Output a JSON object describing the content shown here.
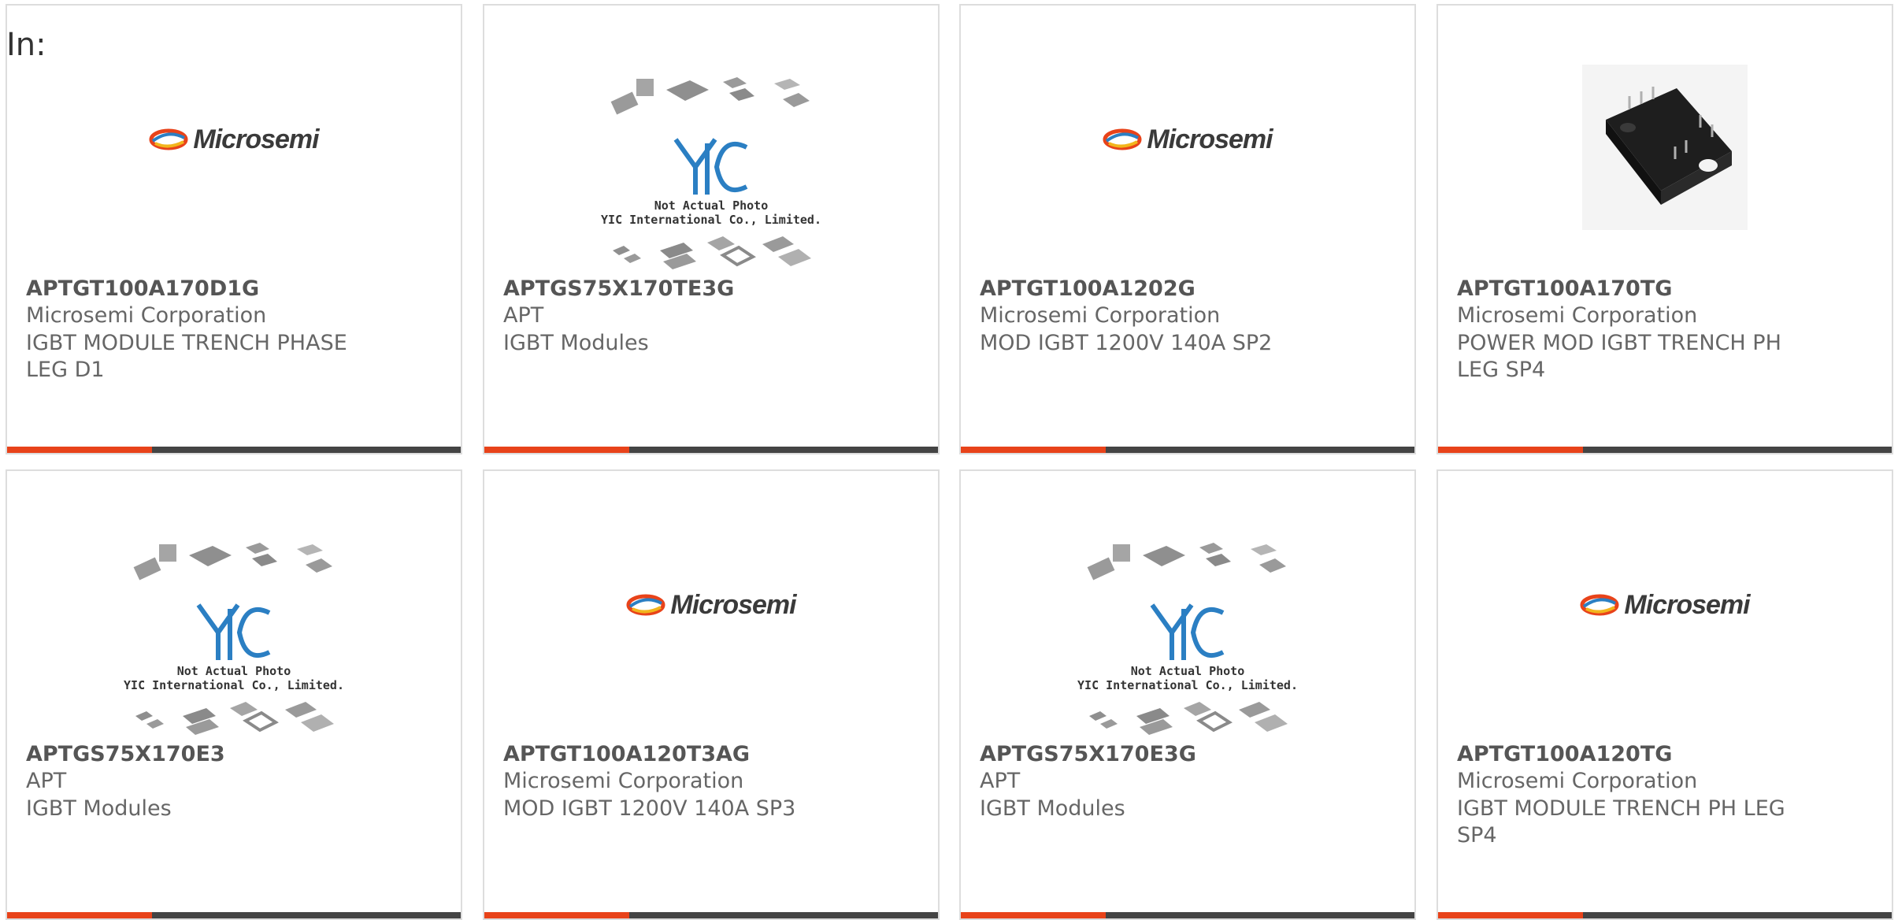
{
  "header": {
    "in_label": "In:"
  },
  "logo_text": "Microsemi",
  "placeholder": {
    "line1": "Not Actual Photo",
    "line2": "YIC International Co., Limited."
  },
  "colors": {
    "accent": "#e8431a",
    "bar": "#444444",
    "border": "#dddddd",
    "yic_blue": "#2b7fc3"
  },
  "products": [
    {
      "part": "APTGT100A170D1G",
      "manufacturer": "Microsemi Corporation",
      "description": "IGBT MODULE TRENCH PHASE LEG D1",
      "image": "microsemi-logo"
    },
    {
      "part": "APTGS75X170TE3G",
      "manufacturer": "APT",
      "description": "IGBT Modules",
      "image": "yic-placeholder"
    },
    {
      "part": "APTGT100A1202G",
      "manufacturer": "Microsemi Corporation",
      "description": "MOD IGBT 1200V 140A SP2",
      "image": "microsemi-logo"
    },
    {
      "part": "APTGT100A170TG",
      "manufacturer": "Microsemi Corporation",
      "description": "POWER MOD IGBT TRENCH PH LEG SP4",
      "image": "igbt-module-photo"
    },
    {
      "part": "APTGS75X170E3",
      "manufacturer": "APT",
      "description": "IGBT Modules",
      "image": "yic-placeholder"
    },
    {
      "part": "APTGT100A120T3AG",
      "manufacturer": "Microsemi Corporation",
      "description": "MOD IGBT 1200V 140A SP3",
      "image": "microsemi-logo"
    },
    {
      "part": "APTGS75X170E3G",
      "manufacturer": "APT",
      "description": "IGBT Modules",
      "image": "yic-placeholder"
    },
    {
      "part": "APTGT100A120TG",
      "manufacturer": "Microsemi Corporation",
      "description": "IGBT MODULE TRENCH PH LEG SP4",
      "image": "microsemi-logo"
    }
  ]
}
